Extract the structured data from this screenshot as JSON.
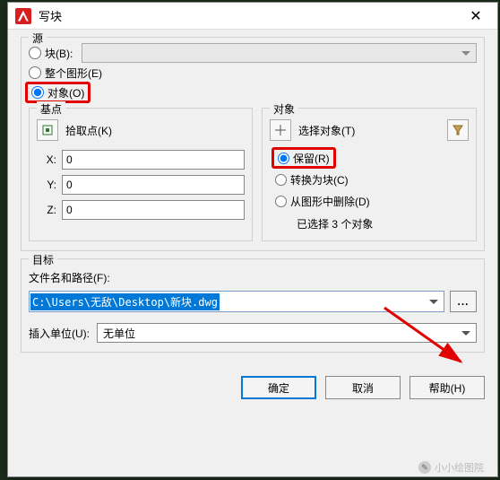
{
  "titlebar": {
    "title": "写块"
  },
  "source": {
    "legend": "源",
    "block_label": "块(B):",
    "whole_label": "整个图形(E)",
    "objects_label": "对象(O)",
    "selected": "objects"
  },
  "basepoint": {
    "legend": "基点",
    "pick_label": "拾取点(K)",
    "x_label": "X:",
    "x": "0",
    "y_label": "Y:",
    "y": "0",
    "z_label": "Z:",
    "z": "0"
  },
  "objects": {
    "legend": "对象",
    "select_label": "选择对象(T)",
    "retain_label": "保留(R)",
    "convert_label": "转换为块(C)",
    "delete_label": "从图形中删除(D)",
    "status": "已选择 3 个对象",
    "selected": "retain"
  },
  "dest": {
    "legend": "目标",
    "path_label": "文件名和路径(F):",
    "path_value": "C:\\Users\\无敌\\Desktop\\新块.dwg",
    "browse_label": "...",
    "unit_label": "插入单位(U):",
    "unit_value": "无单位"
  },
  "buttons": {
    "ok": "确定",
    "cancel": "取消",
    "help": "帮助(H)"
  },
  "watermark": "小小绘图院"
}
